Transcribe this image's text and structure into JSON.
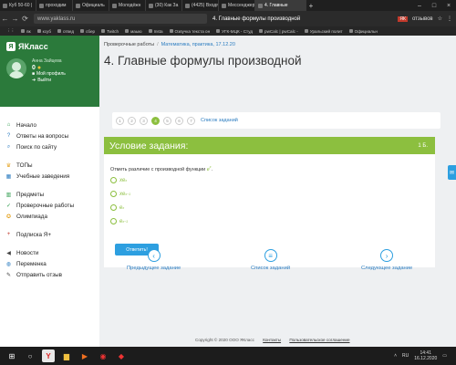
{
  "browser": {
    "tabs": [
      "Куб 50-60 |",
      "проходим",
      "Официаль",
      "Молодёжн",
      "(30) Как За",
      "(4425) Входя",
      "Мессенджер",
      "4. Главные"
    ],
    "active_tab": "4. Главные",
    "url": "www.yaklass.ru",
    "page_title": "4. Главные формулы производной",
    "extension_label": "ЯК",
    "extension_text": "отзывов",
    "bookmarks": [
      "вк",
      "ксуб",
      "отвед",
      "сбер",
      "Twitch",
      "маыю",
      "Insta",
      "Озвучка текста он",
      "УГК-МЦК - Студ",
      "pwCalc | pwCalc -",
      "Уральский полит",
      "Официальн"
    ]
  },
  "sidebar": {
    "logo": "ЯКласс",
    "user_name": "Анна Зайцева",
    "points": "0",
    "my_profile": "Мой профиль",
    "logout": "Выйти",
    "menu": [
      {
        "label": "Начало",
        "icon": "home-icon",
        "color": "#2b9a4b"
      },
      {
        "label": "Ответы на вопросы",
        "icon": "help-icon",
        "color": "#2b7cc0"
      },
      {
        "label": "Поиск по сайту",
        "icon": "search-icon",
        "color": "#2b7cc0"
      },
      {
        "label": "ТОПы",
        "icon": "trophy-icon",
        "color": "#e4a21f"
      },
      {
        "label": "Учебные заведения",
        "icon": "school-icon",
        "color": "#2b7cc0"
      },
      {
        "label": "Предметы",
        "icon": "books-icon",
        "color": "#2b9a4b"
      },
      {
        "label": "Проверочные работы",
        "icon": "check-icon",
        "color": "#2b9a4b"
      },
      {
        "label": "Олимпиада",
        "icon": "medal-icon",
        "color": "#e4a21f"
      },
      {
        "label": "Подписка Я+",
        "icon": "plus-badge-icon",
        "color": "#c0392b"
      },
      {
        "label": "Новости",
        "icon": "megaphone-icon",
        "color": "#444444"
      },
      {
        "label": "Переменка",
        "icon": "chat-icon",
        "color": "#2b7cc0"
      },
      {
        "label": "Отправить отзыв",
        "icon": "feedback-icon",
        "color": "#444444"
      }
    ]
  },
  "main": {
    "breadcrumb_root": "Проверочные работы",
    "breadcrumb_link": "Математика, практика, 17.12.20",
    "title": "4. Главные формулы производной",
    "pages": [
      "1",
      "2",
      "3",
      "4",
      "5",
      "6",
      "7"
    ],
    "active_page": "4",
    "task_list_link": "Список заданий",
    "card_title": "Условие задания:",
    "card_points": "1 Б.",
    "task_text": "Отметь различие с производной функции ",
    "task_fn": "e",
    "task_fn_sup": "x",
    "options": [
      {
        "base": "xe",
        "sup": "x"
      },
      {
        "base": "xe",
        "sup": "x−1"
      },
      {
        "base": "e",
        "sup": "x"
      },
      {
        "base": "e",
        "sup": "x−1"
      }
    ],
    "answer_button": "Ответить!",
    "nav_prev": "Предыдущее задание",
    "nav_list": "Список заданий",
    "nav_next": "Следующее задание",
    "footer_copyright": "Copyright © 2020 ООО ЯКласс",
    "footer_contacts": "Контакты",
    "footer_terms": "Пользовательское соглашение"
  },
  "taskbar": {
    "lang": "RU",
    "time": "14:41",
    "date": "16.12.2020"
  }
}
